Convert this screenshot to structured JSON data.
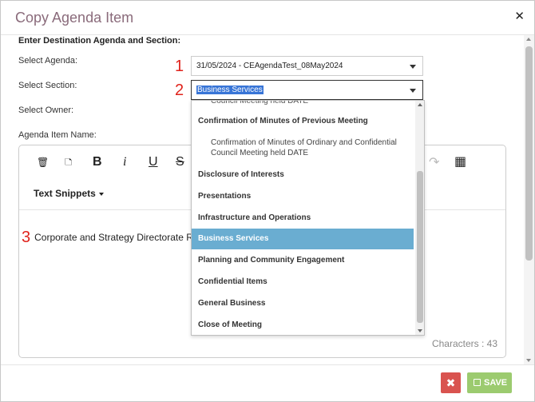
{
  "dialog": {
    "title": "Copy Agenda Item",
    "close_icon": "close-icon"
  },
  "form": {
    "section_heading": "Enter Destination Agenda and Section:",
    "agenda_label": "Select Agenda:",
    "section_label": "Select Section:",
    "owner_label": "Select Owner:",
    "item_name_label": "Agenda Item Name:",
    "agenda_value": "31/05/2024 - CEAgendaTest_08May2024",
    "section_value": "Business Services"
  },
  "markers": {
    "one": "1",
    "two": "2",
    "three": "3"
  },
  "editor": {
    "toolbar": {
      "trash": "🗑",
      "note": "🗅",
      "bold": "B",
      "italic": "i",
      "underline": "U",
      "strike": "S",
      "redo": "↷",
      "table": "▦"
    },
    "text_snippets": "Text Snippets",
    "content": "Corporate and Strategy Directorate Re",
    "char_count": "Characters : 43"
  },
  "dropdown": {
    "partial_top": "Council Meeting held DATE",
    "items": [
      {
        "label": "Confirmation of Minutes of Previous Meeting",
        "sub": false
      },
      {
        "label": "Confirmation of Minutes of Ordinary and Confidential",
        "label2": "Council Meeting held DATE",
        "sub": true
      },
      {
        "label": "Disclosure of Interests",
        "sub": false
      },
      {
        "label": "Presentations",
        "sub": false
      },
      {
        "label": "Infrastructure and Operations",
        "sub": false
      },
      {
        "label": "Business Services",
        "sub": false,
        "selected": true
      },
      {
        "label": "Planning and Community Engagement",
        "sub": false
      },
      {
        "label": "Confidential Items",
        "sub": false
      },
      {
        "label": "General Business",
        "sub": false
      },
      {
        "label": "Close of Meeting",
        "sub": false
      }
    ]
  },
  "footer": {
    "cancel": "✖",
    "save": "SAVE"
  },
  "colors": {
    "title": "#8a6b7b",
    "marker": "#e0231c",
    "selected_item": "#6aadd1",
    "cancel_button": "#d9534f",
    "save_button": "#9ccb6f"
  }
}
